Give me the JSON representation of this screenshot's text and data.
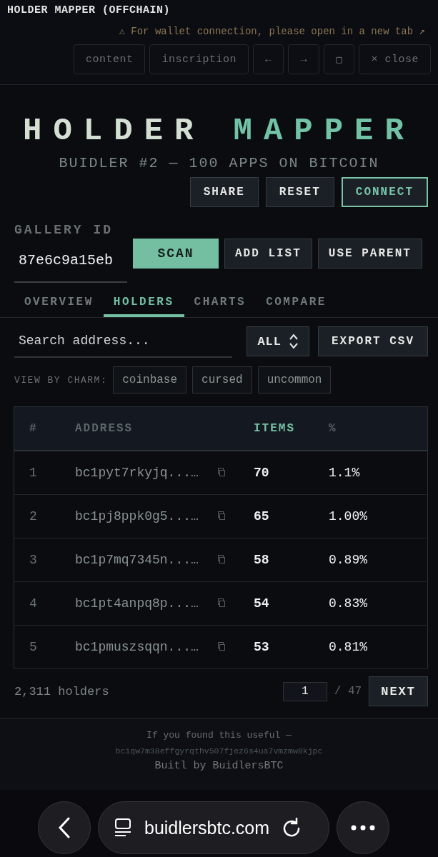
{
  "frame_bar": {
    "title": "HOLDER MAPPER (OFFCHAIN)",
    "notice": "⚠ For wallet connection, please open in a new tab ↗",
    "buttons": [
      "content",
      "inscription",
      "←",
      "→",
      "▢",
      "× close"
    ]
  },
  "header": {
    "title_part_1": "HOLDER",
    "title_part_2": "MAPPER",
    "subtitle": "BUIDLER #2 — 100 APPS ON BITCOIN",
    "actions": [
      {
        "label": "SHARE",
        "kind": "plain"
      },
      {
        "label": "RESET",
        "kind": "plain"
      },
      {
        "label": "CONNECT",
        "kind": "accent"
      }
    ]
  },
  "gallery": {
    "label": "GALLERY ID",
    "value": "87e6c9a15eb",
    "buttons": [
      {
        "label": "SCAN",
        "kind": "primary"
      },
      {
        "label": "ADD LIST",
        "kind": "plain"
      },
      {
        "label": "USE PARENT",
        "kind": "plain"
      }
    ]
  },
  "tabs": [
    {
      "label": "OVERVIEW",
      "selected": false
    },
    {
      "label": "HOLDERS",
      "selected": true
    },
    {
      "label": "CHARTS",
      "selected": false
    },
    {
      "label": "COMPARE",
      "selected": false
    }
  ],
  "search": {
    "placeholder": "Search address...",
    "filter": "ALL",
    "export": "EXPORT CSV"
  },
  "charms": {
    "label": "VIEW BY CHARM:",
    "items": [
      "coinbase",
      "cursed",
      "uncommon"
    ]
  },
  "table": {
    "columns": [
      {
        "label": "#",
        "sorted": false
      },
      {
        "label": "ADDRESS",
        "sorted": false
      },
      {
        "label": "ITEMS",
        "sorted": true
      },
      {
        "label": "%",
        "sorted": false
      }
    ],
    "rows": [
      {
        "rank": "1",
        "address": "bc1pyt7rkyjq...…",
        "items": "70",
        "percent": "1.1%"
      },
      {
        "rank": "2",
        "address": "bc1pj8ppk0g5...…",
        "items": "65",
        "percent": "1.00%"
      },
      {
        "rank": "3",
        "address": "bc1p7mq7345n...…",
        "items": "58",
        "percent": "0.89%"
      },
      {
        "rank": "4",
        "address": "bc1pt4anpq8p...…",
        "items": "54",
        "percent": "0.83%"
      },
      {
        "rank": "5",
        "address": "bc1pmuszsqqn...…",
        "items": "53",
        "percent": "0.81%"
      }
    ]
  },
  "pagination": {
    "count": "2,311 holders",
    "page": "1",
    "total": "/ 47",
    "next": "NEXT"
  },
  "footer": {
    "line_1": "If you found this useful —",
    "address": "bc1qw7m38effgyrqthv507fjez6s4ua7vmzmw8kjpc",
    "credit": "Buitl by BuidlersBTC"
  },
  "browser": {
    "url": "buidlersbtc.com"
  }
}
